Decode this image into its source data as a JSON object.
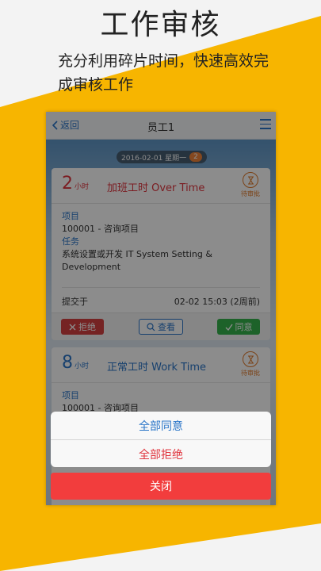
{
  "promo": {
    "headline": "工作审核",
    "subline": "充分利用碎片时间，快速高效完成审核工作"
  },
  "colors": {
    "accent_yellow": "#f7b500",
    "brand_blue": "#2b76c8",
    "danger": "#f23d3d",
    "success": "#36b24b"
  },
  "navbar": {
    "back_label": "返回",
    "title": "员工1",
    "menu_icon": "menu-icon"
  },
  "date_bar": {
    "date": "2016-02-01 星期一",
    "count": "2"
  },
  "cards": [
    {
      "hours": "2",
      "unit": "小时",
      "type": "加班工时 Over Time",
      "type_color": "#e0353e",
      "status": "待审批",
      "project_label": "项目",
      "project": "100001 - 咨询项目",
      "task_label": "任务",
      "task": "系统设置或开发 IT System Setting & Development",
      "submitted_label": "提交于",
      "submitted_time": "02-02 15:03 (2周前)",
      "reject": "拒绝",
      "view": "查看",
      "agree": "同意"
    },
    {
      "hours": "8",
      "unit": "小时",
      "type": "正常工时 Work Time",
      "type_color": "#2b76c8",
      "status": "待审批",
      "project_label": "项目",
      "project": "100001 - 咨询项目"
    }
  ],
  "action_sheet": {
    "approve_all": "全部同意",
    "reject_all": "全部拒绝",
    "close": "关闭"
  }
}
